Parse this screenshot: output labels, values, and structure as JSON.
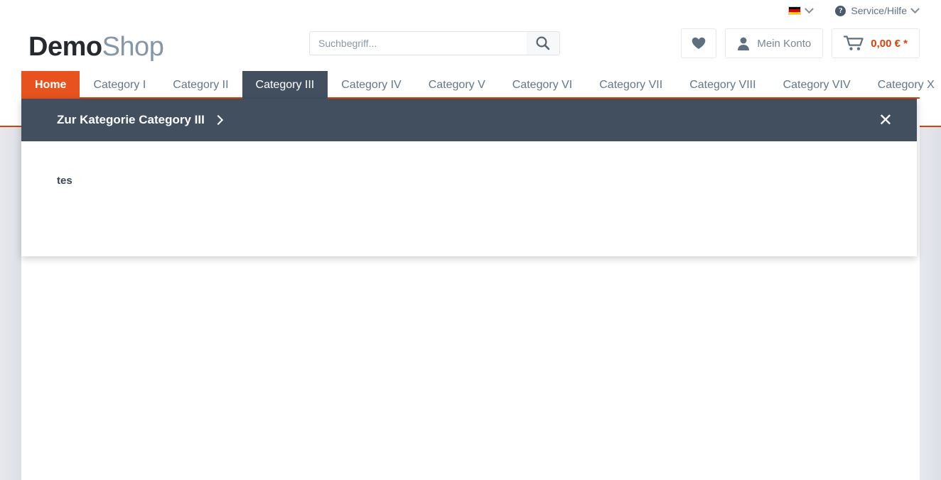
{
  "topbar": {
    "language": {
      "label": "",
      "icon": "german-flag-icon",
      "caret": "chevron-down-icon"
    },
    "service": {
      "label": "Service/Hilfe",
      "icon": "question-circle-icon",
      "caret": "chevron-down-icon"
    }
  },
  "header": {
    "logo": {
      "part1": "Demo",
      "part2": "Shop"
    },
    "search": {
      "placeholder": "Suchbegriff...",
      "value": "",
      "button_icon": "search-icon"
    },
    "actions": {
      "wishlist": {
        "label": "",
        "icon": "heart-icon"
      },
      "account": {
        "label": "Mein Konto",
        "icon": "user-icon"
      },
      "cart": {
        "label": "0,00 € *",
        "icon": "shopping-cart-icon"
      }
    }
  },
  "nav": {
    "items": [
      {
        "label": "Home",
        "state": "home"
      },
      {
        "label": "Category I",
        "state": "default"
      },
      {
        "label": "Category II",
        "state": "default"
      },
      {
        "label": "Category III",
        "state": "active"
      },
      {
        "label": "Category IV",
        "state": "default"
      },
      {
        "label": "Category V",
        "state": "default"
      },
      {
        "label": "Category VI",
        "state": "default"
      },
      {
        "label": "Category VII",
        "state": "default"
      },
      {
        "label": "Category VIII",
        "state": "default"
      },
      {
        "label": "Category VIV",
        "state": "default"
      },
      {
        "label": "Category X",
        "state": "default"
      }
    ]
  },
  "flyout": {
    "title": "Zur Kategorie Category III",
    "title_arrow_icon": "chevron-right-icon",
    "close_label": "✕",
    "entries": [
      {
        "label": "tes"
      }
    ]
  },
  "colors": {
    "accent_orange": "#e7521f",
    "rule_orange": "#d9400b",
    "dark_slate": "#424f5e",
    "muted_text": "#64778a",
    "page_bg": "#e7e9ee"
  }
}
